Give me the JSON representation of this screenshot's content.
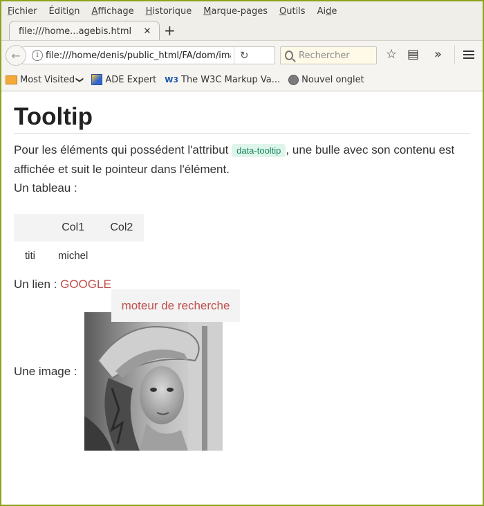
{
  "menu": {
    "items": [
      {
        "label": "Fichier"
      },
      {
        "label": "Édition"
      },
      {
        "label": "Affichage"
      },
      {
        "label": "Historique"
      },
      {
        "label": "Marque-pages"
      },
      {
        "label": "Outils"
      },
      {
        "label": "Aide"
      }
    ]
  },
  "tab": {
    "title": "file:///home...agebis.html",
    "close": "✕",
    "new_tab": "+"
  },
  "nav": {
    "back": "←",
    "info": "i",
    "url": "file:///home/denis/public_html/FA/dom/ima",
    "reload": "↻",
    "search_placeholder": "Rechercher",
    "star": "☆",
    "reader": "▤",
    "overflow": "»"
  },
  "bookmarks": {
    "items": [
      {
        "label": "Most Visited",
        "icon": "folder-icon",
        "chevron": "❯"
      },
      {
        "label": "ADE Expert",
        "icon": "ade-icon"
      },
      {
        "label": "The W3C Markup Va...",
        "icon": "w3c-icon",
        "badge": "W3"
      },
      {
        "label": "Nouvel onglet",
        "icon": "globe-icon"
      }
    ]
  },
  "page": {
    "title": "Tooltip",
    "intro_before": "Pour les éléments qui possédent l'attribut ",
    "intro_code": "data-tooltip",
    "intro_after": ", une bulle avec son contenu est affichée et suit le pointeur dans l'élément.",
    "table_label": "Un tableau :",
    "table": {
      "headers": [
        "",
        "Col1",
        "Col2"
      ],
      "rows": [
        [
          "titi",
          "michel",
          ""
        ]
      ]
    },
    "link_label": "Un lien : ",
    "link_text": "GOOGLE",
    "tooltip_text": "moteur de recherche",
    "image_label": "Une image :"
  }
}
